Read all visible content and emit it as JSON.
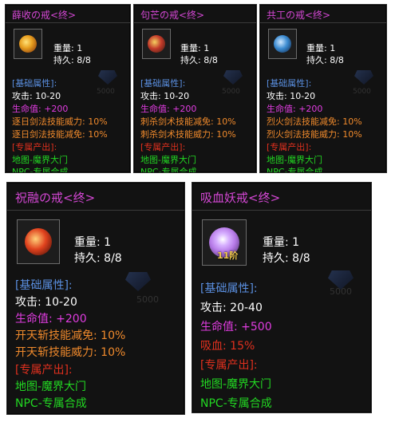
{
  "items": [
    {
      "title": "薛收の戒<终>",
      "weight": "重量: 1",
      "durability": "持久: 8/8",
      "attrs_header": "[基础属性]:",
      "attack": "攻击: 10-20",
      "hp": "生命值: +200",
      "effect1": "逐日剑法技能威力: 10%",
      "effect2": "逐日剑法技能减免: 10%",
      "source_header": "[专属产出]:",
      "map": "地图-魔界大门",
      "npc": "NPC-专属合成",
      "price": "5000",
      "gem_color": "#e8a020"
    },
    {
      "title": "句芒の戒<终>",
      "weight": "重量: 1",
      "durability": "持久: 8/8",
      "attrs_header": "[基础属性]:",
      "attack": "攻击: 10-20",
      "hp": "生命值: +200",
      "effect1": "刺杀剑术技能减免: 10%",
      "effect2": "刺杀剑术技能威力: 10%",
      "source_header": "[专属产出]:",
      "map": "地图-魔界大门",
      "npc": "NPC-专属合成",
      "price": "5000",
      "gem_color": "#c23a2a"
    },
    {
      "title": "共工の戒<终>",
      "weight": "重量: 1",
      "durability": "持久: 8/8",
      "attrs_header": "[基础属性]:",
      "attack": "攻击: 10-20",
      "hp": "生命值: +200",
      "effect1": "烈火剑法技能减免: 10%",
      "effect2": "烈火剑法技能威力: 10%",
      "source_header": "[专属产出]:",
      "map": "地图-魔界大门",
      "npc": "NPC-专属合成",
      "price": "5000",
      "gem_color": "#3a8ad0"
    },
    {
      "title": "祝融の戒<终>",
      "weight": "重量: 1",
      "durability": "持久: 8/8",
      "attrs_header": "[基础属性]:",
      "attack": "攻击: 10-20",
      "hp": "生命值: +200",
      "effect1": "开天斩技能减免: 10%",
      "effect2": "开天斩技能威力: 10%",
      "source_header": "[专属产出]:",
      "map": "地图-魔界大门",
      "npc": "NPC-专属合成",
      "price": "5000",
      "gem_color": "#e0421e"
    },
    {
      "title": "吸血妖戒<终>",
      "weight": "重量: 1",
      "durability": "持久: 8/8",
      "attrs_header": "[基础属性]:",
      "attack": "攻击: 20-40",
      "hp": "生命值: +500",
      "effect1": "吸血: 15%",
      "source_header": "[专属产出]:",
      "map": "地图-魔界大门",
      "npc": "NPC-专属合成",
      "price": "5000",
      "badge": "11阶",
      "gem_color": "#b77be8"
    }
  ]
}
